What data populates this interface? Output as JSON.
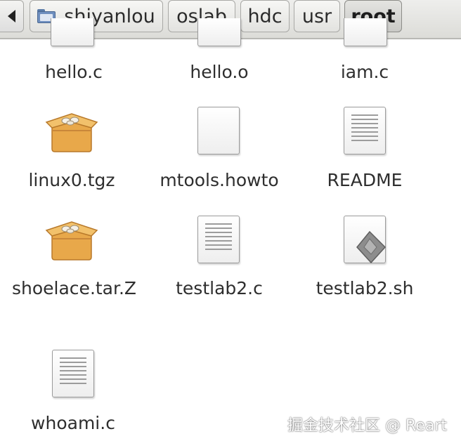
{
  "pathbar": {
    "back_label": "",
    "crumbs": [
      {
        "label": "shiyanlou"
      },
      {
        "label": "oslab"
      },
      {
        "label": "hdc"
      },
      {
        "label": "usr"
      },
      {
        "label": "root"
      }
    ]
  },
  "files": [
    {
      "name": "hello.c",
      "icon": "document-icon"
    },
    {
      "name": "hello.o",
      "icon": "document-icon"
    },
    {
      "name": "iam.c",
      "icon": "document-icon"
    },
    {
      "name": "linux0.tgz",
      "icon": "archive-box-icon"
    },
    {
      "name": "mtools.howto",
      "icon": "blank-document-icon"
    },
    {
      "name": "README",
      "icon": "text-document-icon"
    },
    {
      "name": "shoelace.tar.Z",
      "icon": "archive-box-icon"
    },
    {
      "name": "testlab2.c",
      "icon": "text-document-icon"
    },
    {
      "name": "testlab2.sh",
      "icon": "script-document-icon"
    },
    {
      "name": "whoami.c",
      "icon": "text-document-icon"
    }
  ],
  "watermark": "掘金技术社区 @ Reart",
  "colors": {
    "folder": "#6f8fbf",
    "archive": "#e8a84a",
    "text": "#2e2e2e"
  }
}
